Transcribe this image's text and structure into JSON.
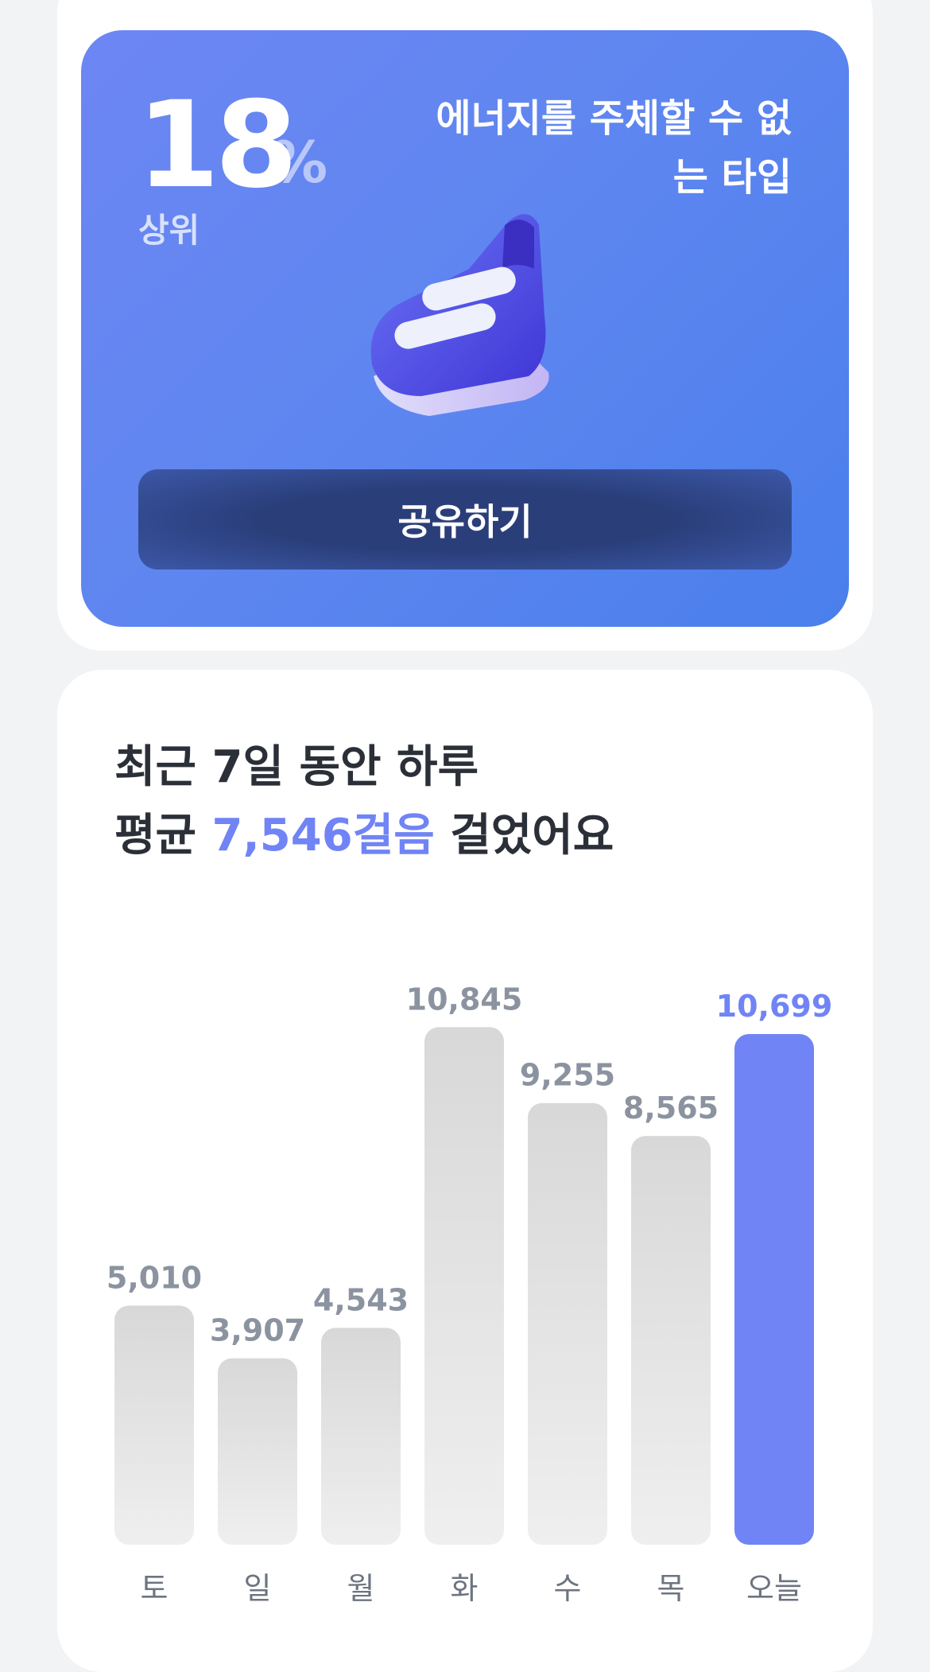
{
  "rank_card": {
    "percent_value": "18",
    "percent_sign": "%",
    "percent_caption": "상위",
    "type_label": "에너지를 주체할 수 없는 타입",
    "shoe_icon": "sneaker-3d-icon",
    "share_button": "공유하기",
    "accent_color": "#6d86f3"
  },
  "weekly": {
    "headline_part1": "최근 7일 동안 하루",
    "headline_part2": "평균 ",
    "headline_highlight": "7,546걸음",
    "headline_part3": " 걸었어요",
    "highlight_color": "#7084f5"
  },
  "chart_data": {
    "type": "bar",
    "categories": [
      "토",
      "일",
      "월",
      "화",
      "수",
      "목",
      "오늘"
    ],
    "values": [
      5010,
      3907,
      4543,
      10845,
      9255,
      8565,
      10699
    ],
    "value_labels": [
      "5,010",
      "3,907",
      "4,543",
      "10,845",
      "9,255",
      "8,565",
      "10,699"
    ],
    "highlight_index": 6,
    "bar_color": "#dcdcdc",
    "highlight_color": "#7084f5"
  }
}
